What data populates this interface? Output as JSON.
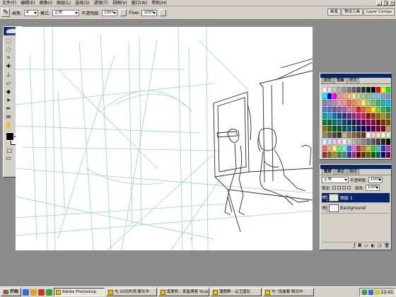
{
  "menu": [
    "文件(F)",
    "编辑(E)",
    "图像(I)",
    "图层(L)",
    "选择(S)",
    "滤镜(T)",
    "视图(V)",
    "窗口(W)",
    "帮助(H)"
  ],
  "options": {
    "brush_label": "画笔:",
    "brush_size": "4",
    "mode_label": "模式:",
    "mode_value": "正常",
    "opacity_label": "不透明度:",
    "opacity_value": "100%",
    "flow_label": "Flow:",
    "flow_value": "100%"
  },
  "palette_well": [
    "画笔",
    "预设工具",
    "Layer Comps"
  ],
  "swatches_panel": {
    "tabs": [
      "颜色",
      "色板",
      "样式"
    ],
    "colors": [
      "#ffffff",
      "#e6e6e6",
      "#cccccc",
      "#b3b3b3",
      "#999999",
      "#808080",
      "#666666",
      "#4d4d4d",
      "#333333",
      "#1a1a1a",
      "#000000",
      "#ff0000",
      "#ffff00",
      "#00ff00",
      "#00ffff",
      "#0000ff",
      "#ff00ff",
      "#f7977a",
      "#fbad82",
      "#fdc68c",
      "#fff799",
      "#c4df9b",
      "#a3d39c",
      "#82ca9c",
      "#7accc8",
      "#6dcff6",
      "#7ea7d8",
      "#8493ca",
      "#8882be",
      "#a187be",
      "#bc8dbf",
      "#f49ac1",
      "#f5989d",
      "#f26c4f",
      "#f68e56",
      "#fbaf5d",
      "#fff467",
      "#acd372",
      "#7cc576",
      "#3bb878",
      "#1abbb4",
      "#00bff3",
      "#438ccb",
      "#5574b9",
      "#605ca8",
      "#855fa8",
      "#a763a9",
      "#f06ea9",
      "#f26d7d",
      "#ed1c24",
      "#f26522",
      "#f7941d",
      "#fff200",
      "#8dc63f",
      "#39b54a",
      "#00a651",
      "#00a99d",
      "#00aeef",
      "#0072bc",
      "#0054a6",
      "#2e3192",
      "#662d91",
      "#92278f",
      "#ec008c",
      "#ed145b",
      "#9e0b0f",
      "#a0410d",
      "#a3620a",
      "#aba000",
      "#598527",
      "#1a7b30",
      "#007236",
      "#00746b",
      "#0076a3",
      "#004a80",
      "#003471",
      "#1b1464",
      "#440e62",
      "#630460",
      "#9e005d",
      "#9e0039",
      "#790000",
      "#7b2e00",
      "#7d4900",
      "#827b00",
      "#406618",
      "#005e20",
      "#005826",
      "#005952",
      "#005b7f",
      "#003663",
      "#002157",
      "#0d004c",
      "#32004b",
      "#4b0049",
      "#7b0046",
      "#7a0026",
      "#c69c6d",
      "#998675",
      "#736357",
      "#534741",
      "#362f2d",
      "#c7b299",
      "#a67c52",
      "#8c6239",
      "#754c24",
      "#603913",
      "#ffffff",
      "#ffd5d5",
      "#ffe6cc",
      "#ffffcc",
      "#d9ffcc",
      "#ccffff",
      "#cce0ff",
      "#e0ccff",
      "#ffccf2",
      "#f2f2f2",
      "#d9d9d9",
      "#bfbfbf",
      "#a6a6a6",
      "#8c8c8c",
      "#737373",
      "#595959",
      "#404040",
      "#262626",
      "#0d0d0d",
      "#ff6666",
      "#ffb366",
      "#ffff66",
      "#66ff66",
      "#66ffff",
      "#6666ff",
      "#ff66ff",
      "#cc3333",
      "#cc8033",
      "#cccc33",
      "#33cc33",
      "#33cccc",
      "#3333cc",
      "#cc33cc",
      "#993333",
      "#996633",
      "#999933",
      "#339933",
      "#339999",
      "#333399",
      "#993399",
      "#660000",
      "#663300",
      "#666600",
      "#006600",
      "#006666",
      "#000066",
      "#660066"
    ]
  },
  "layers_panel": {
    "tabs": [
      "图层",
      "通道",
      "路径"
    ],
    "mode": "正常",
    "opacity_label": "不透明度:",
    "opacity_value": "100%",
    "lock_label": "锁定:",
    "fill_label": "填充:",
    "fill_value": "100%",
    "layers": [
      {
        "name": "图层 1",
        "selected": true
      },
      {
        "name": "Background",
        "selected": false
      }
    ]
  },
  "taskbar": {
    "start": "开始",
    "tasks": [
      {
        "label": "Adobe Photoshop",
        "active": true
      },
      {
        "label": "与 10天的洞 聊天中",
        "active": false
      },
      {
        "label": "炼摩机 - 茶晶博客 Youbl...",
        "active": false
      },
      {
        "label": "潘朗群 - 云王国在",
        "active": false
      },
      {
        "label": "与 \"连露着 聊天中",
        "active": false
      }
    ],
    "clock": "12:41"
  }
}
